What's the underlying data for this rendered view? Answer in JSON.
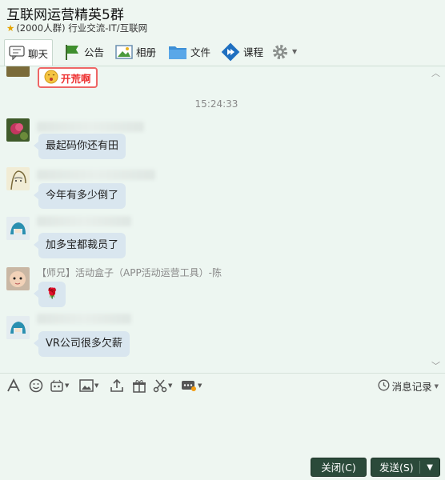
{
  "header": {
    "title": "互联网运营精英5群",
    "member_count": "(2000人群)",
    "category": "行业交流-IT/互联网"
  },
  "tabs": [
    {
      "label": "聊天"
    },
    {
      "label": "公告"
    },
    {
      "label": "相册"
    },
    {
      "label": "文件"
    },
    {
      "label": "课程"
    }
  ],
  "chat": {
    "sticker_text": "开荒啊",
    "timestamp": "15:24:33",
    "messages": [
      {
        "text": "最起码你还有田"
      },
      {
        "text": "今年有多少倒了"
      },
      {
        "text": "加多宝都裁员了"
      },
      {
        "sender": "【师兄】活动盒子（APP活动运营工具）-陈",
        "text": "🌹"
      },
      {
        "text": "VR公司很多欠薪"
      }
    ]
  },
  "toolbar": {
    "history_label": "消息记录"
  },
  "actions": {
    "close_label": "关闭(C)",
    "send_label": "发送(S)"
  },
  "colors": {
    "background": "#eef6f1",
    "bubble": "#d9e6ef",
    "button": "#2b4a3a"
  }
}
